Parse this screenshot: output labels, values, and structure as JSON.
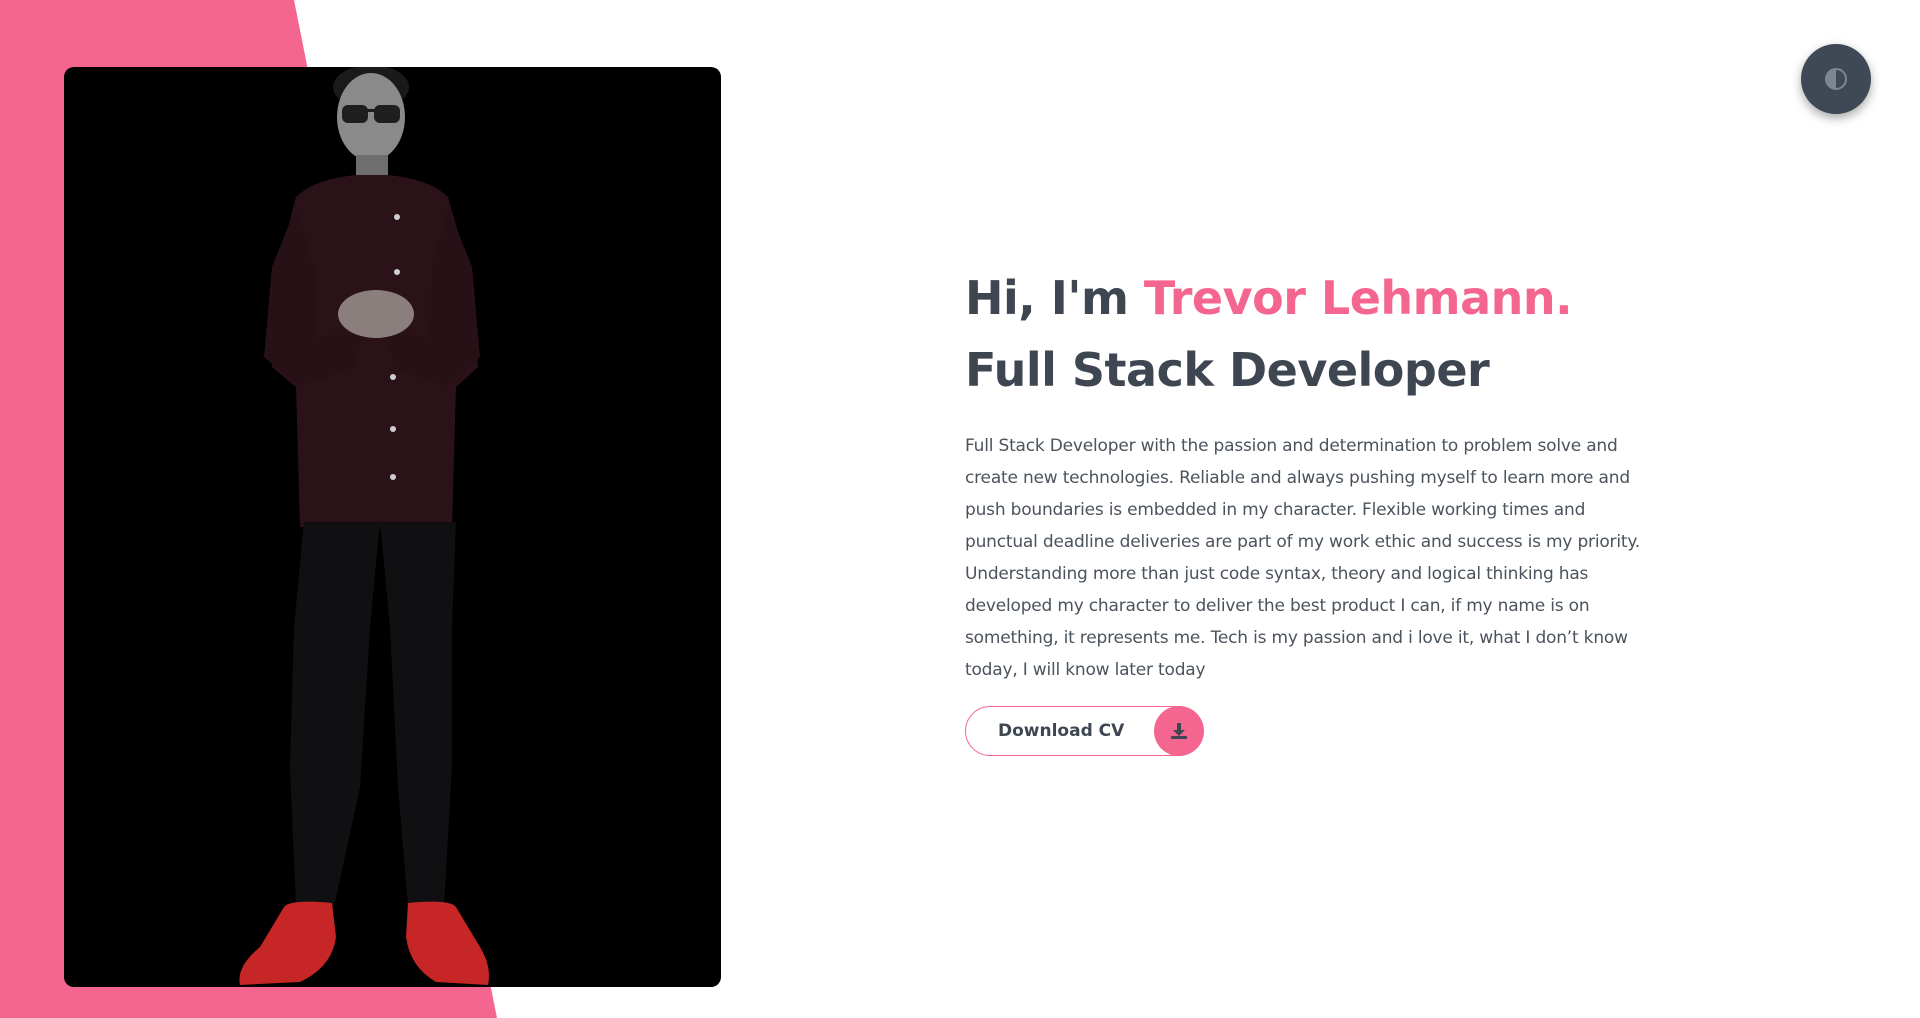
{
  "hero": {
    "greeting": "Hi, I'm ",
    "name": "Trevor Lehmann.",
    "role": "Full Stack Developer",
    "description": "Full Stack Developer with the passion and determination to problem solve and create new technologies. Reliable and always pushing myself to learn more and push boundaries is embedded in my character. Flexible working times and punctual deadline deliveries are part of my work ethic and success is my priority. Understanding more than just code syntax, theory and logical thinking has developed my character to deliver the best product I can, if my name is on something, it represents me. Tech is my passion and i love it, what I don’t know today, I will know later today",
    "download_label": "Download CV"
  },
  "icons": {
    "theme_toggle": "contrast-icon",
    "download": "download-icon"
  },
  "colors": {
    "accent": "#f4668f",
    "heading": "#3e4651",
    "body_text": "#4b535c",
    "toggle_bg": "#3f4955",
    "photo_bg": "#000000"
  }
}
